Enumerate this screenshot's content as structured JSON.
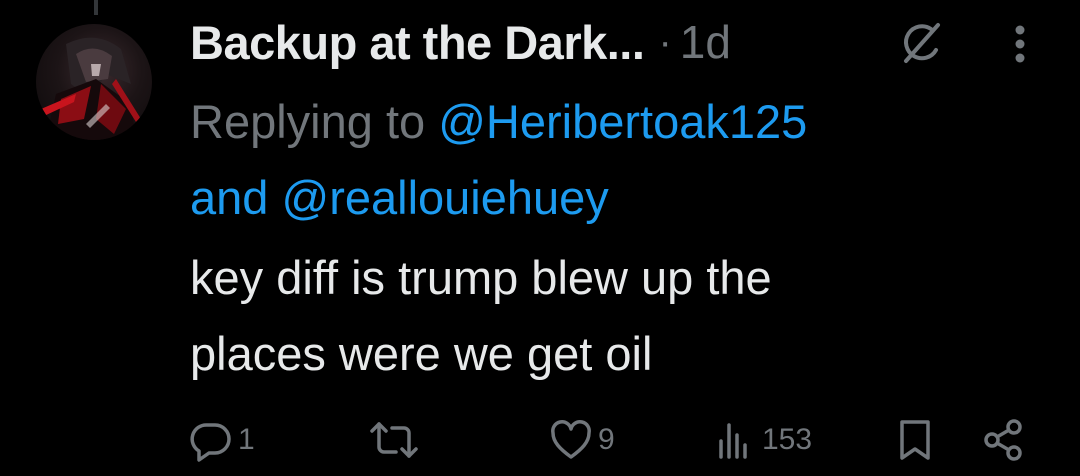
{
  "tweet": {
    "display_name": "Backup at the Dark...",
    "separator": "·",
    "time": "1d",
    "reply_prefix": "Replying to ",
    "mention_1": "@Heribertoak125",
    "reply_and": "and ",
    "mention_2": "@reallouiehuey",
    "text_line_1": "key diff is trump blew up the",
    "text_line_2": "places were we get oil"
  },
  "actions": {
    "reply_count": "1",
    "repost_count": "",
    "like_count": "9",
    "views_count": "153"
  },
  "icons": {
    "grok": "grok-icon",
    "more": "more-vertical-icon",
    "reply": "reply-icon",
    "repost": "repost-icon",
    "like": "heart-icon",
    "views": "views-chart-icon",
    "bookmark": "bookmark-icon",
    "share": "share-icon"
  },
  "colors": {
    "background": "#000000",
    "text_primary": "#e7e9ea",
    "text_secondary": "#71767b",
    "link": "#1d9bf0",
    "thread_line": "#333639"
  }
}
